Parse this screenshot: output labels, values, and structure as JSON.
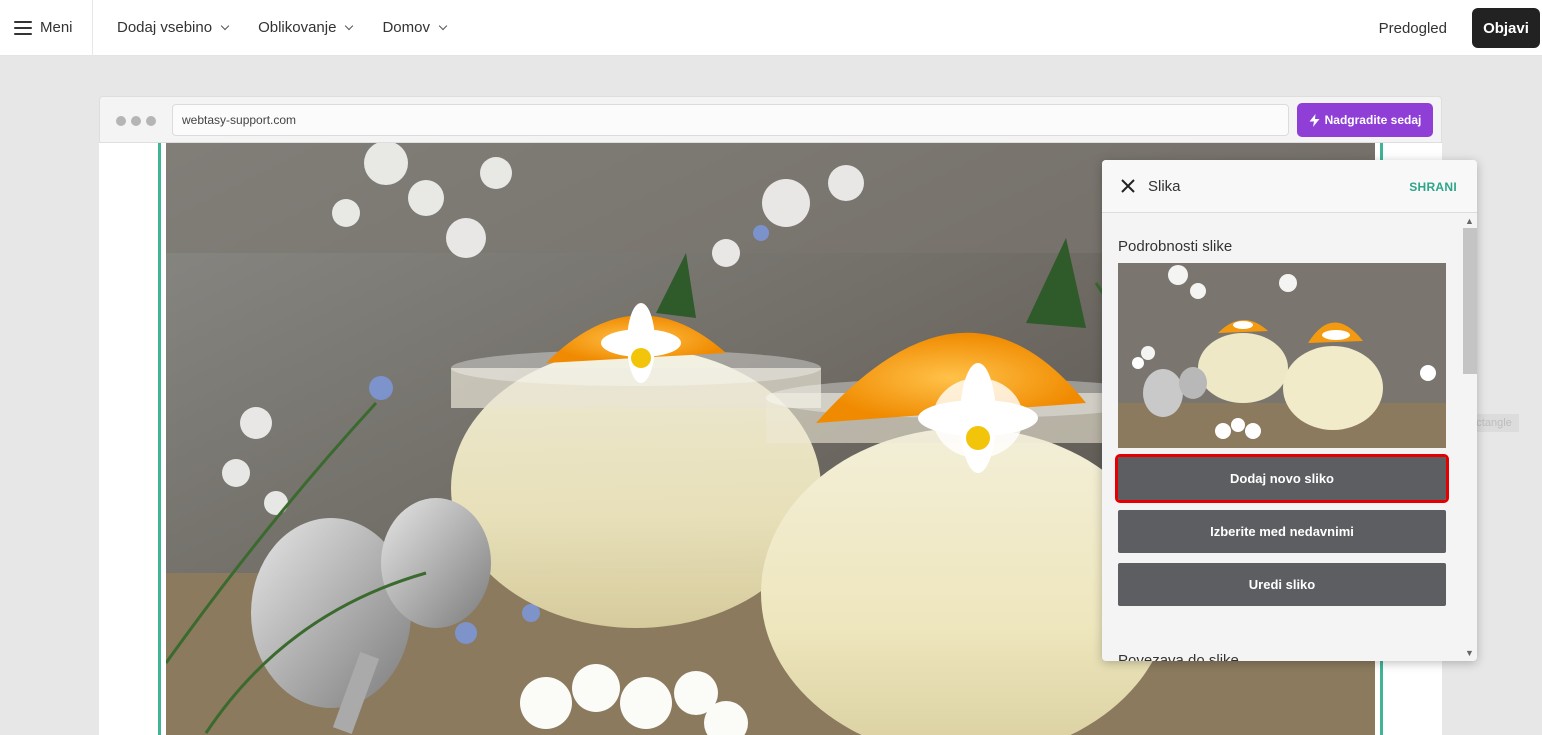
{
  "topbar": {
    "menu_label": "Meni",
    "nav": [
      {
        "label": "Dodaj vsebino"
      },
      {
        "label": "Oblikovanje"
      },
      {
        "label": "Domov"
      }
    ],
    "preview_label": "Predogled",
    "publish_label": "Objavi"
  },
  "browser": {
    "url": "webtasy-support.com",
    "upgrade_label": "Nadgradite sedaj",
    "upgrade_color": "#8f3fd6"
  },
  "canvas": {
    "selection_color": "#3fb596",
    "element_label": "Rectangle"
  },
  "panel": {
    "title": "Slika",
    "save_label": "SHRANI",
    "section_title": "Podrobnosti slike",
    "buttons": {
      "add_new": "Dodaj novo sliko",
      "choose_recent": "Izberite med nedavnimi",
      "edit": "Uredi sliko"
    },
    "next_section_title": "Povezava do slike"
  }
}
